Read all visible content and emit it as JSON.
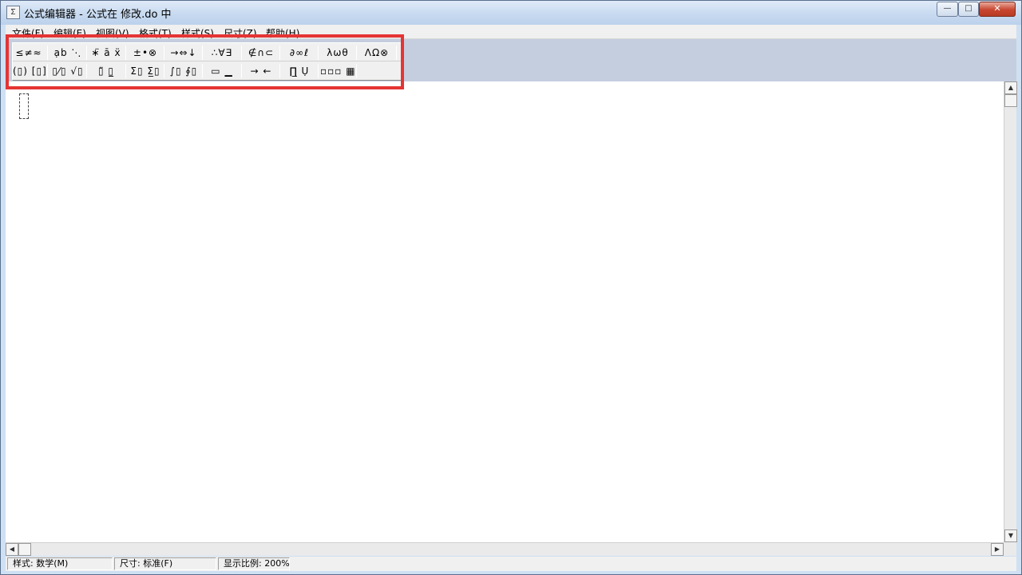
{
  "window": {
    "title": "公式编辑器 - 公式在 修改.do 中",
    "icon_glyph": "Σ",
    "controls": {
      "minimize_glyph": "—",
      "maximize_glyph": "□",
      "close_glyph": "✕"
    }
  },
  "menu": {
    "items": [
      {
        "label": "文件(F)"
      },
      {
        "label": "编辑(E)"
      },
      {
        "label": "视图(V)"
      },
      {
        "label": "格式(T)"
      },
      {
        "label": "样式(S)"
      },
      {
        "label": "尺寸(Z)"
      },
      {
        "label": "帮助(H)"
      }
    ]
  },
  "palette": {
    "row1": [
      {
        "name": "relations",
        "glyphs": "≤≠≈"
      },
      {
        "name": "spaces-ellipses",
        "glyphs": "ạb ⋱"
      },
      {
        "name": "embellishments",
        "glyphs": "∗̈ ā ẍ"
      },
      {
        "name": "operators",
        "glyphs": "±•⊗"
      },
      {
        "name": "arrows",
        "glyphs": "→⇔↓"
      },
      {
        "name": "logic",
        "glyphs": "∴∀∃"
      },
      {
        "name": "set-theory",
        "glyphs": "∉∩⊂"
      },
      {
        "name": "misc-symbols",
        "glyphs": "∂∞ℓ"
      },
      {
        "name": "greek-lower",
        "glyphs": "λωθ"
      },
      {
        "name": "greek-upper",
        "glyphs": "ΛΩ⊗"
      }
    ],
    "row2": [
      {
        "name": "fences",
        "glyphs": "(▯) [▯]"
      },
      {
        "name": "fractions-radicals",
        "glyphs": "▯⁄▯ √▯"
      },
      {
        "name": "subscripts-superscripts",
        "glyphs": "▯̈ ▯̲"
      },
      {
        "name": "summations",
        "glyphs": "Σ▯ Σ̲▯"
      },
      {
        "name": "integrals",
        "glyphs": "∫▯ ∮▯"
      },
      {
        "name": "underbars-overbars",
        "glyphs": "▭ ▁"
      },
      {
        "name": "labeled-arrows",
        "glyphs": "→ ←"
      },
      {
        "name": "products-sets",
        "glyphs": "∏̲ Ụ"
      },
      {
        "name": "matrices",
        "glyphs": "▫▫▫ ▦"
      }
    ]
  },
  "statusbar": {
    "style": "样式: 数学(M)",
    "size": "尺寸: 标准(F)",
    "zoom": "显示比例: 200%"
  }
}
